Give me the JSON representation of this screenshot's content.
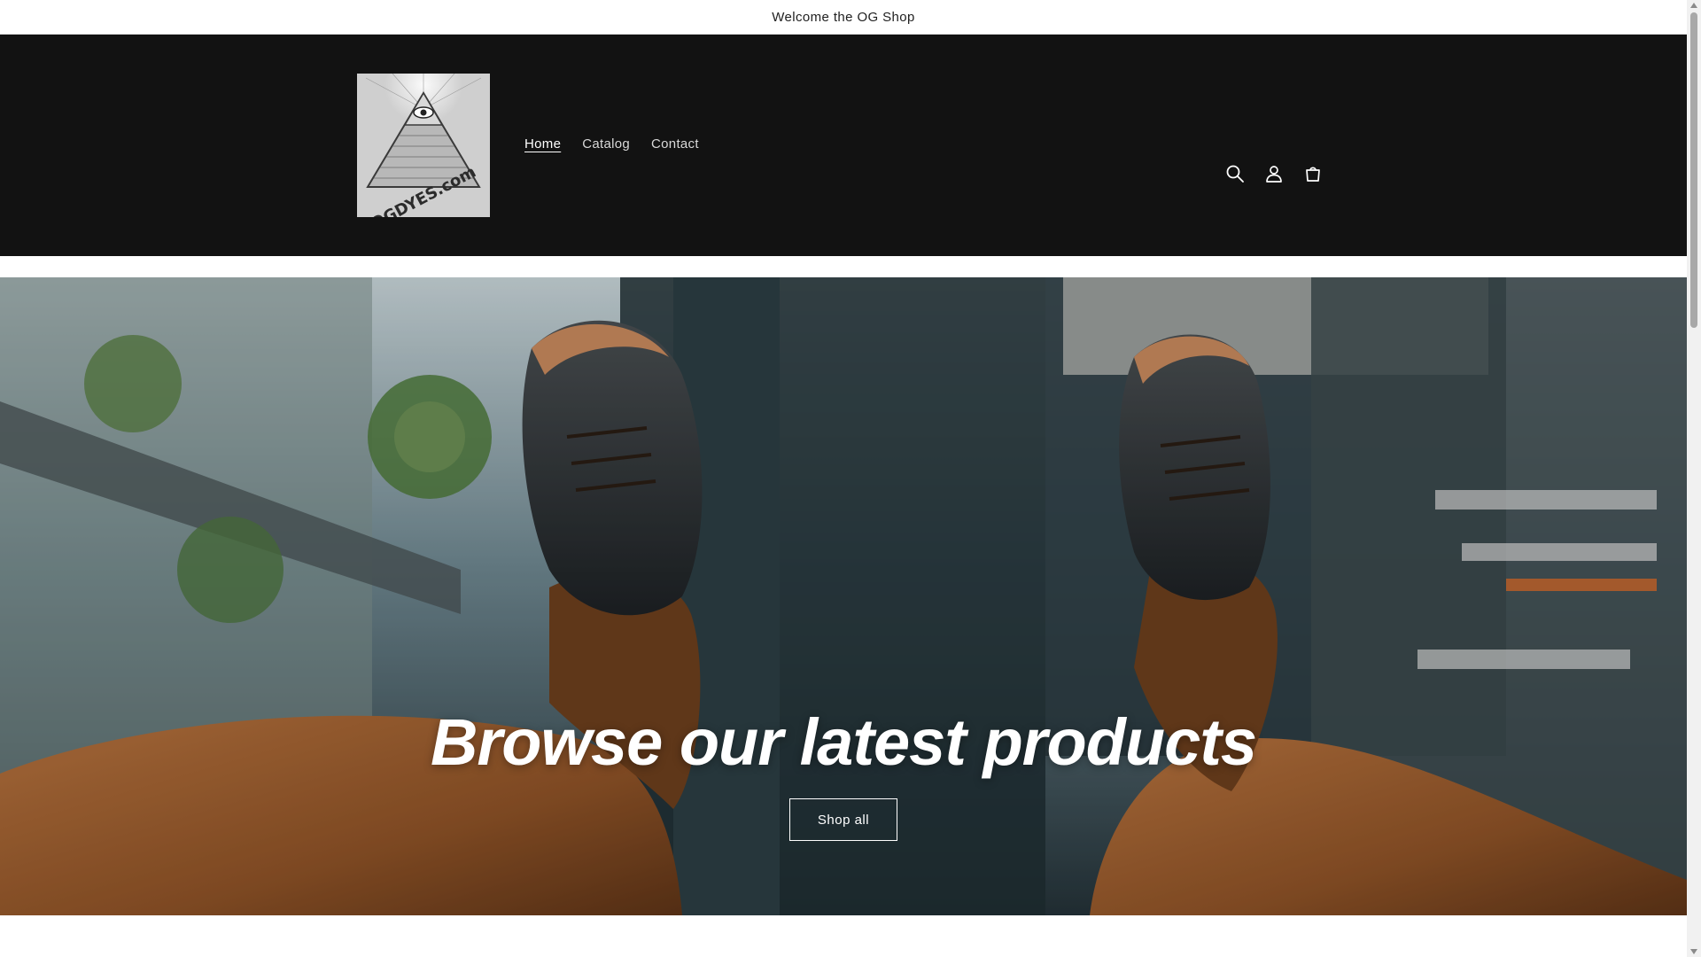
{
  "announcement": {
    "text": "Welcome the OG Shop"
  },
  "header": {
    "logo_text": "OGDYES.com",
    "nav": [
      {
        "label": "Home",
        "active": true
      },
      {
        "label": "Catalog",
        "active": false
      },
      {
        "label": "Contact",
        "active": false
      }
    ],
    "icons": [
      "search-icon",
      "account-icon",
      "cart-icon"
    ]
  },
  "hero": {
    "title": "Browse our latest products",
    "button_label": "Shop all"
  },
  "colors": {
    "header_bg": "#121212",
    "announcement_bg": "#ffffff",
    "hero_text": "#ffffff"
  }
}
